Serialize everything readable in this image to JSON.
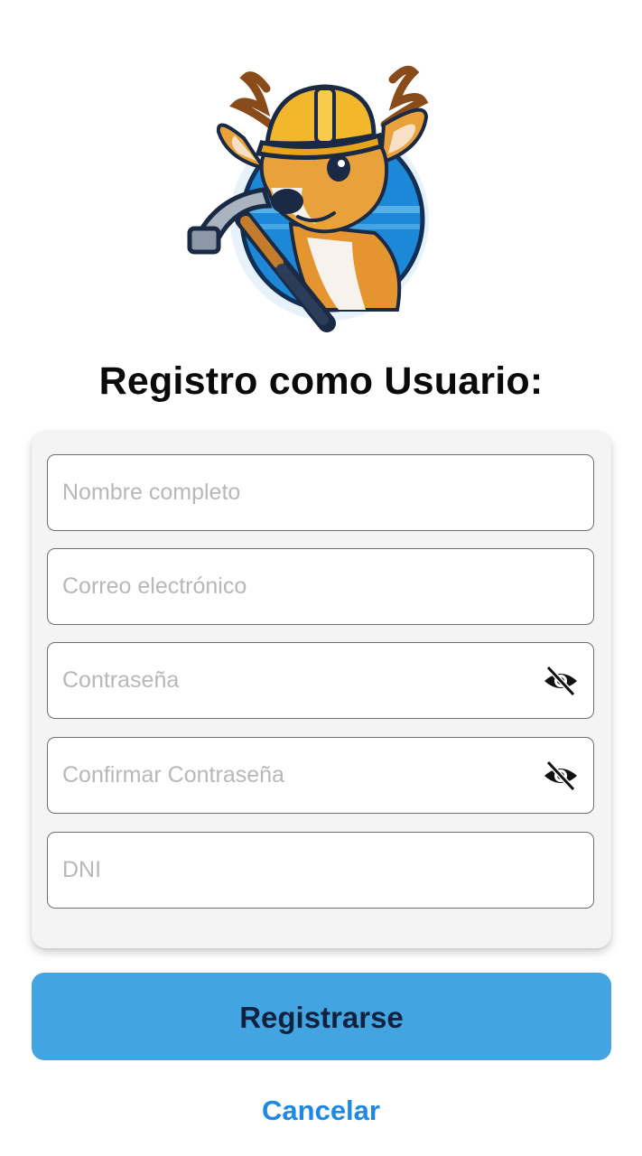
{
  "header": {
    "logo_icon": "deer-construction-worker-logo",
    "title": "Registro como Usuario:"
  },
  "form": {
    "fields": [
      {
        "placeholder": "Nombre completo",
        "value": ""
      },
      {
        "placeholder": "Correo electrónico",
        "value": ""
      },
      {
        "placeholder": "Contraseña",
        "value": "",
        "icon": "eye-off-icon"
      },
      {
        "placeholder": "Confirmar Contraseña",
        "value": "",
        "icon": "eye-off-icon"
      },
      {
        "placeholder": "DNI",
        "value": ""
      }
    ]
  },
  "actions": {
    "submit_label": "Registrarse",
    "cancel_label": "Cancelar"
  },
  "colors": {
    "primary": "#42a5e2",
    "primary_text": "#10223f",
    "link": "#1e88e5",
    "card_bg": "#f4f4f4"
  }
}
